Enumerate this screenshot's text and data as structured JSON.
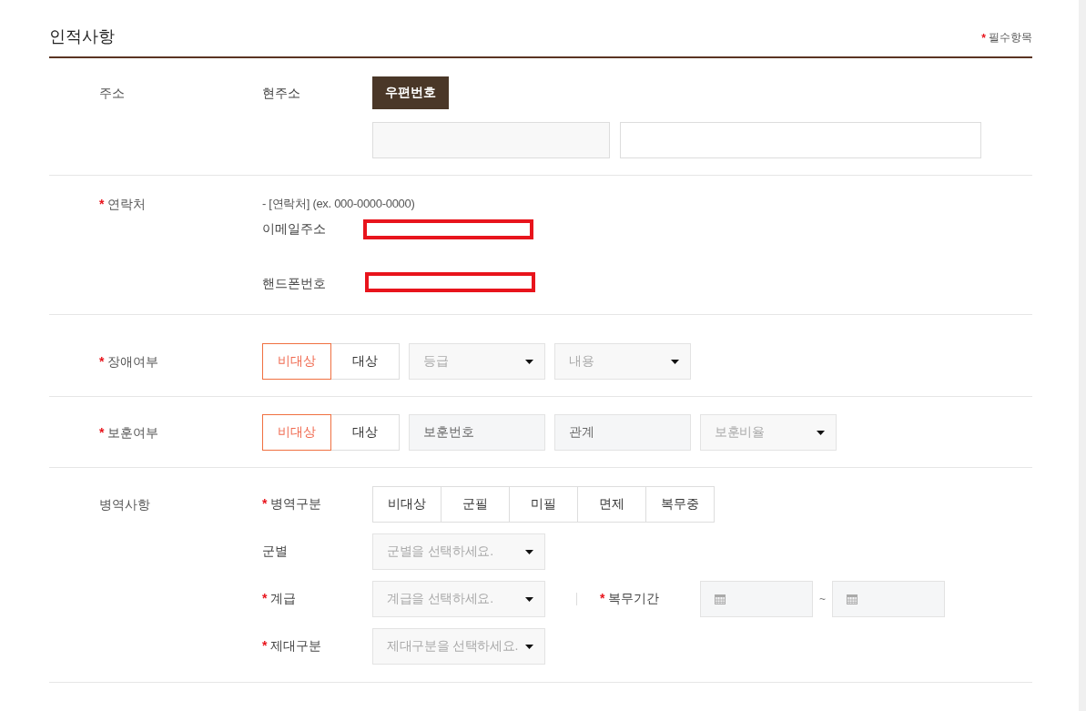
{
  "header": {
    "title": "인적사항",
    "note_mark": "*",
    "note": "필수항목"
  },
  "sections": [
    {
      "kind": "address",
      "label": "주소",
      "sub_label": "현주소",
      "button": "우편번호",
      "fields": [
        {
          "kind": "readonly"
        },
        {
          "kind": "text"
        }
      ]
    },
    {
      "kind": "contact",
      "mark": "*",
      "label": "연락처",
      "hint": "- [연락처] (ex. 000-0000-0000)",
      "rows": [
        {
          "label": "이메일주소"
        },
        {
          "label": "핸드폰번호"
        }
      ]
    },
    {
      "kind": "choice",
      "mark": "*",
      "label": "장애여부",
      "options": [
        {
          "label": "비대상",
          "selected": true
        },
        {
          "label": "대상",
          "selected": false
        }
      ],
      "controls": [
        {
          "kind": "select",
          "placeholder": "등급"
        },
        {
          "kind": "select",
          "placeholder": "내용"
        }
      ]
    },
    {
      "kind": "choice",
      "mark": "*",
      "label": "보훈여부",
      "options": [
        {
          "label": "비대상",
          "selected": true
        },
        {
          "label": "대상",
          "selected": false
        }
      ],
      "controls": [
        {
          "kind": "input",
          "placeholder": "보훈번호"
        },
        {
          "kind": "input",
          "placeholder": "관계"
        },
        {
          "kind": "select",
          "placeholder": "보훈비율"
        }
      ]
    },
    {
      "kind": "military",
      "label": "병역사항",
      "category": {
        "mark": "*",
        "label": "병역구분",
        "options": [
          {
            "label": "비대상",
            "selected": false
          },
          {
            "label": "군필",
            "selected": false
          },
          {
            "label": "미필",
            "selected": false
          },
          {
            "label": "면제",
            "selected": false
          },
          {
            "label": "복무중",
            "selected": false
          }
        ]
      },
      "fields": [
        {
          "label": "군별",
          "placeholder": "군별을 선택하세요."
        },
        {
          "mark": "*",
          "label": "계급",
          "placeholder": "계급을 선택하세요.",
          "period": {
            "mark": "*",
            "label": "복무기간",
            "separator": "~"
          }
        },
        {
          "mark": "*",
          "label": "제대구분",
          "placeholder": "제대구분을 선택하세요."
        }
      ]
    }
  ]
}
